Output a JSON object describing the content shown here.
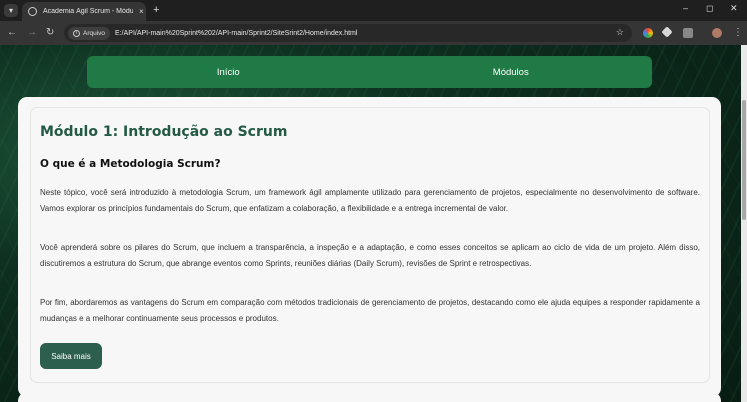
{
  "browser": {
    "tab_title": "Academia Ágil Scrum - Módulos",
    "new_tab": "+",
    "close": "×",
    "minimize": "–",
    "maximize": "◻",
    "window_close": "✕",
    "site_chip": "Arquivo",
    "url": "E:/API/API-main%20Sprint%202/API-main/Sprint2/SiteSrint2/Home/index.html"
  },
  "nav": {
    "items": [
      {
        "label": "Início"
      },
      {
        "label": "Módulos"
      }
    ]
  },
  "module": {
    "title": "Módulo 1: Introdução ao Scrum",
    "subtitle": "O que é a Metodologia Scrum?",
    "paragraphs": [
      "Neste tópico, você será introduzido à metodologia Scrum, um framework ágil amplamente utilizado para gerenciamento de projetos, especialmente no desenvolvimento de software. Vamos explorar os princípios fundamentais do Scrum, que enfatizam a colaboração, a flexibilidade e a entrega incremental de valor.",
      "Você aprenderá sobre os pilares do Scrum, que incluem a transparência, a inspeção e a adaptação, e como esses conceitos se aplicam ao ciclo de vida de um projeto. Além disso, discutiremos a estrutura do Scrum, que abrange eventos como Sprints, reuniões diárias (Daily Scrum), revisões de Sprint e retrospectivas.",
      "Por fim, abordaremos as vantagens do Scrum em comparação com métodos tradicionais de gerenciamento de projetos, destacando como ele ajuda equipes a responder rapidamente a mudanças e a melhorar continuamente seus processos e produtos."
    ],
    "button_label": "Saiba mais"
  },
  "colors": {
    "nav_bg": "#1f7a45",
    "title": "#245a45",
    "button": "#2d5f4e"
  }
}
